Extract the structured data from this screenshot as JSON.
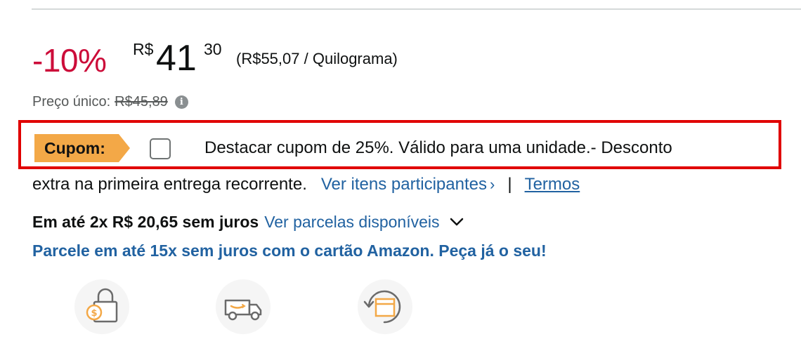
{
  "price": {
    "discount": "-10%",
    "currency_symbol": "R$",
    "whole": "41",
    "fraction": "30",
    "unit_price": "(R$55,07 / Quilograma)"
  },
  "list_price": {
    "label": "Preço único:",
    "value": "R$45,89",
    "info_icon": "i"
  },
  "coupon": {
    "badge": "Cupom:",
    "checked": false,
    "text_line1": "Destacar cupom de 25%. Válido para uma unidade.- Desconto",
    "text_line2": "extra na primeira entrega recorrente.",
    "participating_link": "Ver itens participantes",
    "chevron": "›",
    "separator": "|",
    "terms_link": "Termos"
  },
  "installments": {
    "bold_text": "Em até 2x R$ 20,65 sem juros",
    "link": "Ver parcelas disponíveis"
  },
  "amazon_card_promo": "Parcele em até 15x sem juros com o cartão Amazon. Peça já o seu!",
  "feature_icons": [
    "secure-payment-icon",
    "delivery-truck-icon",
    "return-box-icon"
  ],
  "colors": {
    "discount": "#cc0c39",
    "link": "#2162a1",
    "coupon_badge": "#f3a847",
    "highlight_border": "#e00000",
    "icon_accent": "#f3a847"
  }
}
